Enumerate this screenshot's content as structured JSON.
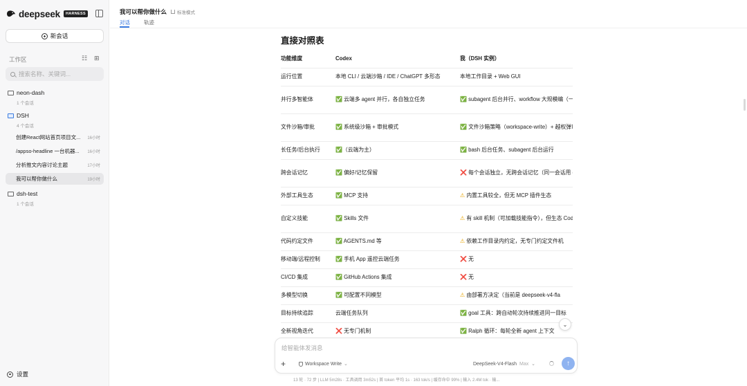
{
  "sidebar": {
    "brand": "deepseek",
    "badge": "HARNESS",
    "new_chat": "新会话",
    "workspace_label": "工作区",
    "search_placeholder": "搜索名称、关键词...",
    "folders": [
      {
        "name": "neon-dash",
        "sub": "1 个会话"
      },
      {
        "name": "DSH",
        "sub": "4 个会话"
      },
      {
        "name": "dsh-test",
        "sub": "1 个会话"
      }
    ],
    "sessions": [
      {
        "title": "创建React网站首页项目文...",
        "time": "16小时"
      },
      {
        "title": "/appso-headline 一台机器...",
        "time": "16小时"
      },
      {
        "title": "分析推文内容讨论主题",
        "time": "17小时"
      },
      {
        "title": "我可以帮你做什么",
        "time": "19小时"
      }
    ],
    "settings": "设置"
  },
  "header": {
    "title": "我可以帮你做什么",
    "mode": "标准模式",
    "tabs": [
      "对话",
      "轨迹"
    ]
  },
  "content": {
    "heading": "直接对照表",
    "table": {
      "headers": [
        "功能维度",
        "Codex",
        "我（DSH 实例）"
      ],
      "rows": [
        {
          "dim": "运行位置",
          "codex": "本地 CLI / 云端沙箱 / IDE / ChatGPT 多形态",
          "dsh": "本地工作目录 + Web GUI"
        },
        {
          "dim": "并行多智能体",
          "codex": "✅ 云端多 agent 并行，各自独立任务",
          "dsh": "✅ subagent 后台并行、workflow 大规模编（一次几百个子任务）"
        },
        {
          "dim": "文件沙箱/审批",
          "codex": "✅ 系统级沙箱 + 审批模式",
          "dsh": "✅ 文件沙箱策略（workspace-write）+ 越权弹审批"
        },
        {
          "dim": "长任务/后台执行",
          "codex": "✅（云端为主）",
          "dsh": "✅ bash 后台任务、subagent 后台运行"
        },
        {
          "dim": "跨会话记忆",
          "codex": "✅ 偏好/记忆保留",
          "dsh": "❌ 每个会话独立，无跨会话记忆（同一会话用 goal 持续追踪）"
        },
        {
          "dim": "外部工具生态",
          "codex": "✅ MCP 支持",
          "dsh": "⚠️ 内置工具较全，但无 MCP 插件生态"
        },
        {
          "dim": "自定义技能",
          "codex": "✅ Skills 文件",
          "dsh": "⚠️ 有 skill 机制（可加载技能指令），但生态 Codex"
        },
        {
          "dim": "代码约定文件",
          "codex": "✅ AGENTS.md 等",
          "dsh": "⚠️ 依赖工作目录内约定，无专门约定文件机"
        },
        {
          "dim": "移动端/远程控制",
          "codex": "✅ 手机 App 遥控云端任务",
          "dsh": "❌ 无"
        },
        {
          "dim": "CI/CD 集成",
          "codex": "✅ GitHub Actions 集成",
          "dsh": "❌ 无"
        },
        {
          "dim": "多模型切换",
          "codex": "✅ 可配置不同模型",
          "dsh": "⚠️ 由部署方决定（当前是 deepseek-v4-fla"
        },
        {
          "dim": "目标持续追踪",
          "codex": "云端任务队列",
          "dsh": "✅ goal 工具：跨自动轮次持续推进同一目标"
        },
        {
          "dim": "全新视角迭代",
          "codex": "❌ 无专门机制",
          "dsh": "✅ Ralph 循环：每轮全新 agent 上下文"
        }
      ]
    }
  },
  "composer": {
    "placeholder": "给智能体发消息",
    "workspace": "Workspace Write",
    "model": "DeepSeek-V4-Flash",
    "model_variant": "Max"
  },
  "status_line": "13 轮 · 72 步  |  LLM 5m28s · 工具调用 3m52s  |  首 token 平均 1s · 163 tok/s  |  缓存命中 99%  |  输入 2.4M tok · 输..."
}
